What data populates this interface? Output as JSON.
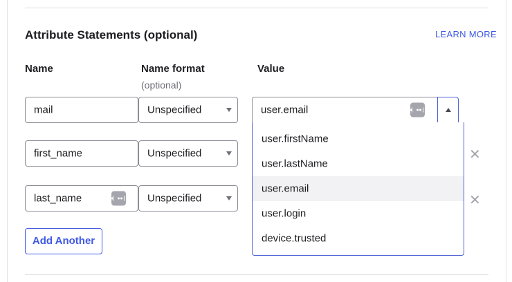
{
  "section": {
    "title": "Attribute Statements (optional)",
    "learn_more": "LEARN MORE"
  },
  "columns": {
    "name": "Name",
    "name_format": "Name format",
    "name_format_sub": "(optional)",
    "value": "Value"
  },
  "rows": [
    {
      "name": "mail",
      "format": "Unspecified",
      "value": "user.email"
    },
    {
      "name": "first_name",
      "format": "Unspecified",
      "value": ""
    },
    {
      "name": "last_name",
      "format": "Unspecified",
      "value": ""
    }
  ],
  "dropdown": {
    "options": [
      "user.firstName",
      "user.lastName",
      "user.email",
      "user.login",
      "device.trusted"
    ],
    "highlighted": "user.email"
  },
  "icons": {
    "remove": "close-icon",
    "expression": "expression-editor-icon",
    "caret": "chevron-down-icon"
  },
  "colors": {
    "accent": "#3f59e4",
    "text": "#1d1d21",
    "muted": "#6e6e78"
  },
  "buttons": {
    "add_another": "Add Another",
    "remove_glyph": "✕"
  }
}
